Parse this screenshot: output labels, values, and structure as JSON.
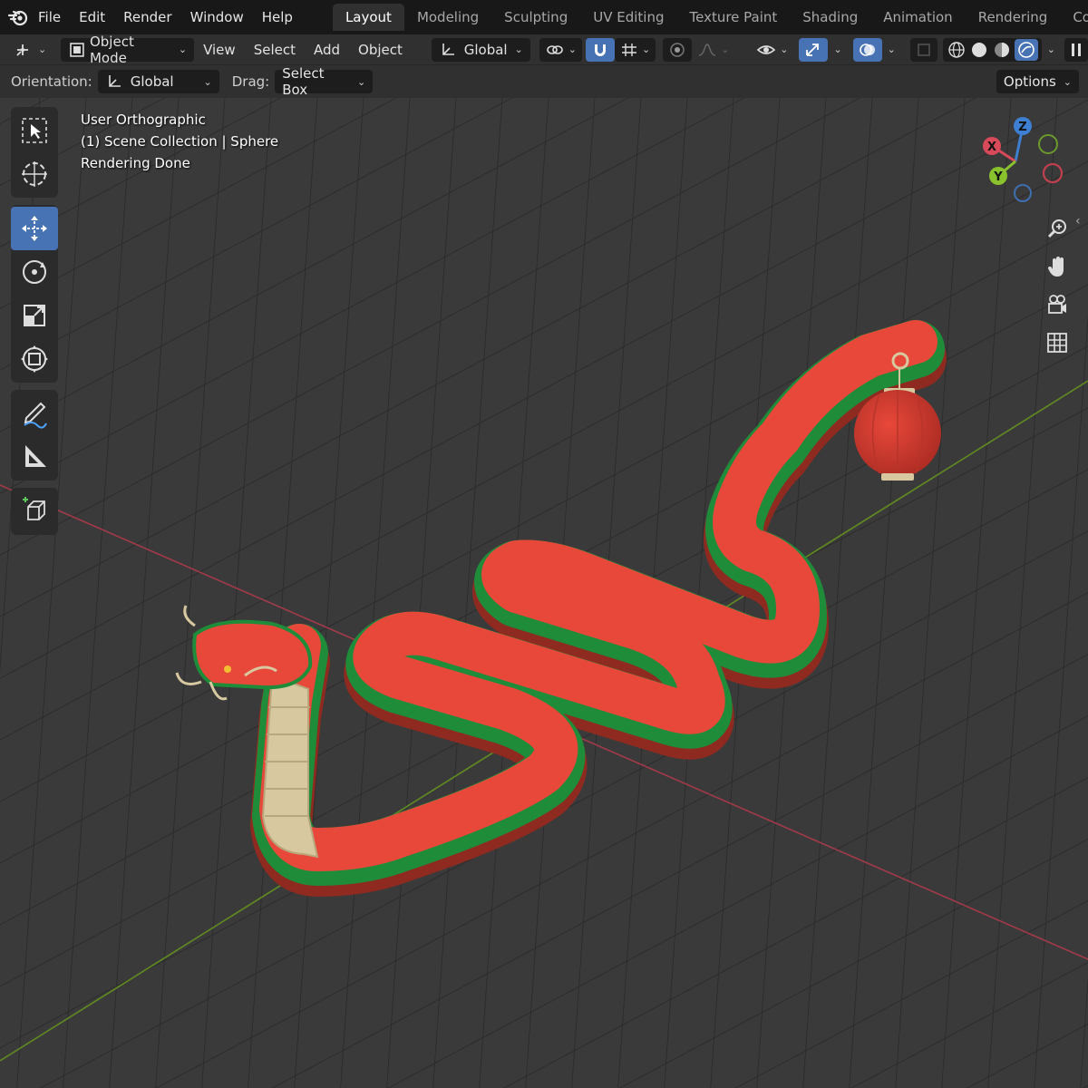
{
  "menu": [
    "File",
    "Edit",
    "Render",
    "Window",
    "Help"
  ],
  "workspaces": [
    {
      "label": "Layout",
      "active": true
    },
    {
      "label": "Modeling"
    },
    {
      "label": "Sculpting"
    },
    {
      "label": "UV Editing"
    },
    {
      "label": "Texture Paint"
    },
    {
      "label": "Shading"
    },
    {
      "label": "Animation"
    },
    {
      "label": "Rendering"
    },
    {
      "label": "Com"
    }
  ],
  "header": {
    "mode": "Object Mode",
    "view": "View",
    "select": "Select",
    "add": "Add",
    "object": "Object",
    "transform_orientation": "Global"
  },
  "toolsettings": {
    "orientation_label": "Orientation:",
    "orientation_value": "Global",
    "drag_label": "Drag:",
    "drag_value": "Select Box",
    "options": "Options"
  },
  "overlay": {
    "view_name": "User Orthographic",
    "collection": "(1) Scene Collection | Sphere",
    "status": "Rendering Done"
  },
  "gizmo": {
    "x": "X",
    "y": "Y",
    "z": "Z"
  },
  "colors": {
    "accent_blue": "#4772b3",
    "axis_x": "#c0404e",
    "axis_y": "#6a9a2a",
    "snake_red": "#e8483a",
    "snake_green": "#1f8c3a",
    "belly": "#d8c8a0"
  },
  "toolbar_tools": [
    "select-box-icon",
    "cursor-icon",
    "move-icon",
    "rotate-icon",
    "scale-icon",
    "transform-icon",
    "annotate-icon",
    "measure-icon",
    "add-cube-icon"
  ],
  "nav_buttons": [
    "zoom-icon",
    "pan-hand-icon",
    "camera-icon",
    "grid-view-icon"
  ]
}
